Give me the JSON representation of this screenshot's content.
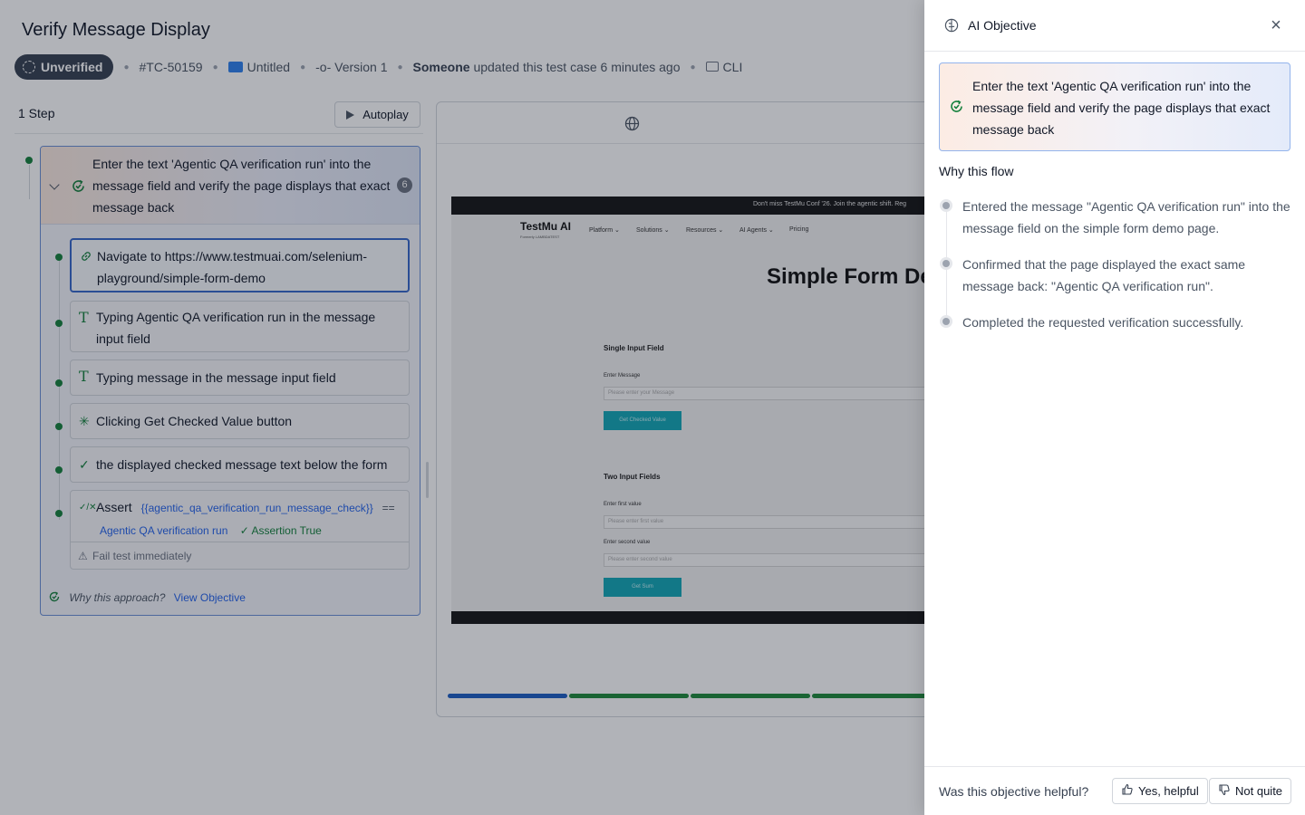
{
  "page": {
    "title": "Verify Message Display",
    "status_badge": "Unverified",
    "test_id": "#TC-50159",
    "folder": "Untitled",
    "version": "Version 1",
    "updated_by": "Someone",
    "updated_text": "updated this test case 6 minutes ago",
    "cli": "CLI"
  },
  "steps": {
    "count_label": "1 Step",
    "autoplay_label": "Autoplay",
    "main_step": {
      "text": "Enter the text 'Agentic QA verification run' into the message field and verify the page displays that exact message back",
      "substep_count": "6"
    },
    "substeps": [
      {
        "icon": "link-icon",
        "text": "Navigate to https://www.testmuai.com/selenium-playground/simple-form-demo"
      },
      {
        "icon": "type-icon",
        "text": "Typing Agentic QA verification run in the message input field"
      },
      {
        "icon": "type-icon",
        "text": "Typing message in the message input field"
      },
      {
        "icon": "click-icon",
        "text": "Clicking Get Checked Value button"
      },
      {
        "icon": "check-icon",
        "text": "the displayed checked message text below the form"
      }
    ],
    "assert": {
      "label": "Assert",
      "variable": "{{agentic_qa_verification_run_message_check}}",
      "operator": "==",
      "value": "Agentic QA verification run",
      "result": "Assertion True",
      "fail_option": "Fail test immediately"
    },
    "why_approach": "Why this approach?",
    "view_objective": "View Objective"
  },
  "preview": {
    "banner": "Don't miss TestMu Conf '26. Join the agentic shift. Reg",
    "logo": "TestMu AI",
    "logo_sub": "Formerly LAMBDATEST",
    "nav": [
      "Platform ⌄",
      "Solutions ⌄",
      "Resources ⌄",
      "AI Agents ⌄",
      "Pricing"
    ],
    "heading": "Simple Form Der",
    "single_section": "Single Input Field",
    "enter_message_label": "Enter Message",
    "enter_message_placeholder": "Please enter your Message",
    "get_checked_btn": "Get Checked Value",
    "two_section": "Two Input Fields",
    "first_label": "Enter first value",
    "first_placeholder": "Please enter first value",
    "second_label": "Enter second value",
    "second_placeholder": "Please enter second value",
    "get_sum_btn": "Get Sum",
    "progress_colors": [
      "#1d5fc4",
      "#1f8a3b",
      "#1f8a3b",
      "#1f8a3b"
    ]
  },
  "drawer": {
    "title": "AI Objective",
    "objective": "Enter the text 'Agentic QA verification run' into the message field and verify the page displays that exact message back",
    "why_flow": "Why this flow",
    "flow_items": [
      "Entered the message \"Agentic QA verification run\" into the message field on the simple form demo page.",
      "Confirmed that the page displayed the exact same message back: \"Agentic QA verification run\".",
      "Completed the requested verification successfully."
    ],
    "feedback_question": "Was this objective helpful?",
    "yes_label": "Yes, helpful",
    "no_label": "Not quite"
  },
  "colors": {
    "accent_blue": "#2563eb",
    "success_green": "#15803d",
    "badge_dark": "#374151"
  }
}
